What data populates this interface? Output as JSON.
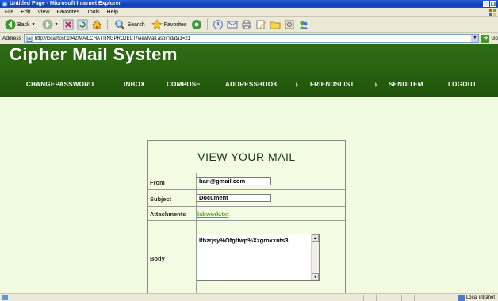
{
  "window": {
    "title": "Untitled Page - Microsoft Internet Explorer",
    "controls": [
      "_",
      "❐"
    ]
  },
  "menu": [
    "File",
    "Edit",
    "View",
    "Favorites",
    "Tools",
    "Help"
  ],
  "toolbar": {
    "back_label": "Back",
    "search_label": "Search",
    "favorites_label": "Favorites"
  },
  "address": {
    "label": "Address",
    "url": "http://localhost:1042/MAILCHATTINGPROJECT/ViewMail.aspx?data1=21",
    "go_label": "Go"
  },
  "site": {
    "title": "Cipher Mail System",
    "nav": [
      "CHANGEPASSWORD",
      "INBOX",
      "COMPOSE",
      "ADDRESSBOOK",
      "FRIENDSLIST",
      "SENDITEM",
      "LOGOUT"
    ]
  },
  "mail": {
    "heading": "VIEW YOUR MAIL",
    "from_label": "From",
    "from_value": "hari@gmail.com",
    "subject_label": "Subject",
    "subject_value": "Document",
    "attachments_label": "Attachments",
    "attachment_name": "labwork.txt",
    "body_label": "Body",
    "body_value": "Ithzrjsy%Ofg!twp%Xzgrnxxnts3"
  },
  "status": {
    "zone": "Local intranet"
  },
  "colors": {
    "header_green": "#2a6510",
    "page_bg": "#f1fbe0",
    "link_green": "#6b9a3a",
    "xp_blue": "#0a3fb8"
  }
}
